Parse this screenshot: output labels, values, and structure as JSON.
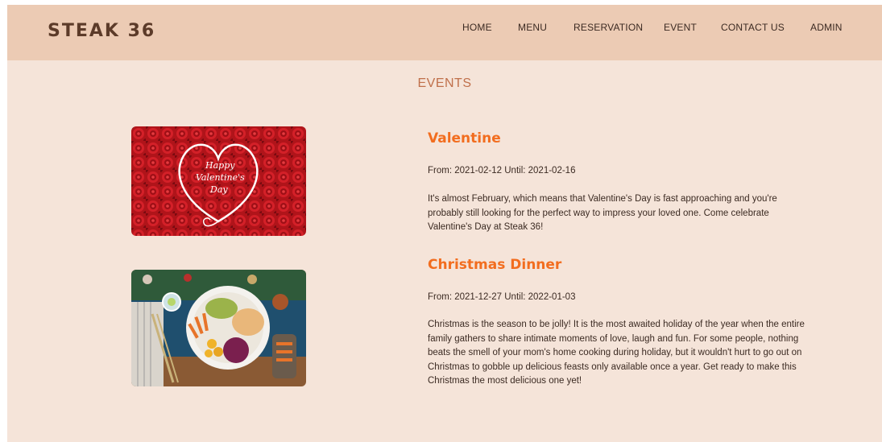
{
  "brand": "STEAK 36",
  "nav": [
    "HOME",
    "MENU",
    "RESERVATION",
    "EVENT",
    "CONTACT US",
    "ADMIN"
  ],
  "section_title": "EVENTS",
  "events": [
    {
      "title": "Valentine",
      "dates": "From: 2021-02-12 Until: 2021-02-16",
      "description": "It's almost February, which means that Valentine's Day is fast approaching and you're probably still looking for the perfect way to impress your loved one. Come celebrate Valentine's Day at Steak 36!",
      "image_text": [
        "Happy",
        "Valentine's",
        "Day"
      ]
    },
    {
      "title": "Christmas Dinner",
      "dates": "From: 2021-12-27 Until: 2022-01-03",
      "description": "Christmas is the season to be jolly! It is the most awaited holiday of the year when the entire family gathers to share intimate moments of love, laugh and fun. For some people, nothing beats the smell of your mom's home cooking during holiday, but it wouldn't hurt to go out on Christmas to gobble up delicious feasts only available once a year. Get ready to make this Christmas the most delicious one yet!"
    }
  ],
  "colors": {
    "page_bg": "#f5e4d9",
    "navbar_bg": "#eccbb4",
    "brand": "#5c3b29",
    "section_title": "#c0704b",
    "event_title": "#f26d1f"
  }
}
